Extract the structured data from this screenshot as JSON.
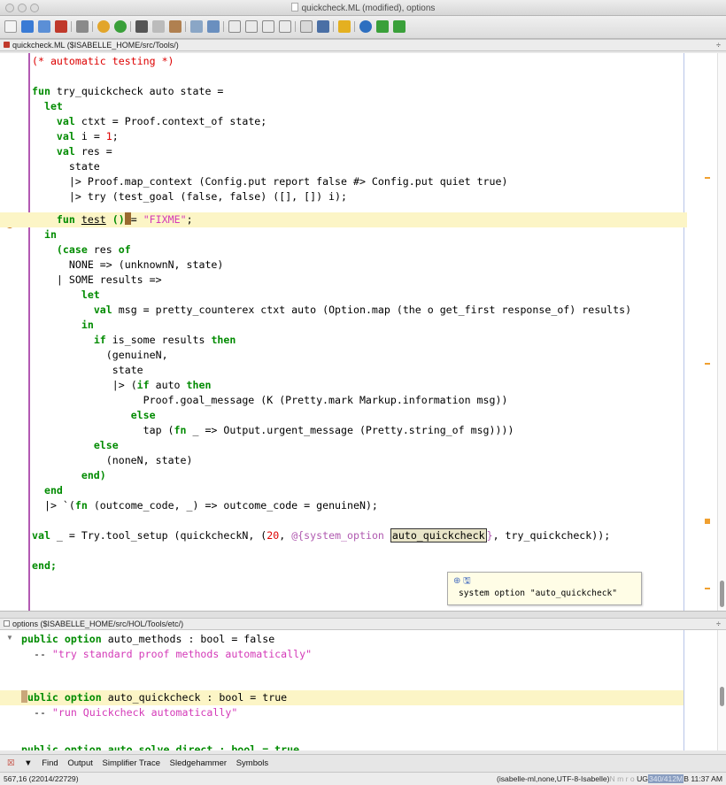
{
  "window": {
    "title": "quickcheck.ML (modified), options"
  },
  "buffer1": {
    "label": "quickcheck.ML ($ISABELLE_HOME/src/Tools/)",
    "dropdown": "÷"
  },
  "buffer2": {
    "label": "options ($ISABELLE_HOME/src/HOL/Tools/etc/)",
    "dropdown": "÷"
  },
  "code": {
    "l01": "(* automatic testing *)",
    "l03a": "fun",
    "l03b": " try_quickcheck auto state =",
    "l04": "let",
    "l05a": "val",
    "l05b": " ctxt = Proof.context_of state;",
    "l06a": "val",
    "l06b": " i = ",
    "l06c": "1",
    "l06d": ";",
    "l07a": "val",
    "l07b": " res =",
    "l08": "state",
    "l09": "|> Proof.map_context (Config.put report false #> Config.put quiet true)",
    "l10": "|> try (test_goal (false, false) ([], []) i);",
    "l11a": "fun",
    "l11b": "test",
    "l11c": " ()",
    "l11d": "= ",
    "l11e": "\"FIXME\"",
    "l11f": ";",
    "l12": "in",
    "l13a": "(",
    "l13b": "case",
    "l13c": " res ",
    "l13d": "of",
    "l14": "NONE => (unknownN, state)",
    "l15": "| SOME results =>",
    "l16": "let",
    "l17a": "val",
    "l17b": " msg = pretty_counterex ctxt auto (Option.map (the o get_first response_of) results)",
    "l18": "in",
    "l19a": "if",
    "l19b": " is_some results ",
    "l19c": "then",
    "l20": "(genuineN,",
    "l21": "state",
    "l22a": "|> (",
    "l22b": "if",
    "l22c": " auto ",
    "l22d": "then",
    "l23": "Proof.goal_message (K (Pretty.mark Markup.information msg))",
    "l24": "else",
    "l25a": "tap (",
    "l25b": "fn",
    "l25c": " _ => Output.urgent_message (Pretty.string_of msg))))",
    "l26": "else",
    "l27": "(noneN, state)",
    "l28": "end)",
    "l29": "end",
    "l30a": "|> `(",
    "l30b": "fn",
    "l30c": " (outcome_code, _) => outcome_code = genuineN);",
    "l32a": "val",
    "l32b": " _ = Try.tool_setup (quickcheckN, (",
    "l32c": "20",
    "l32d": ", ",
    "l32e": "@{system_option ",
    "l32f": "auto_quickcheck",
    "l32g": "}",
    "l32h": ", try_quickcheck));",
    "l34": "end;"
  },
  "tooltip": {
    "icons": "⊕ 🖫",
    "text": "system option \"auto_quickcheck\""
  },
  "options": {
    "o1a": "public option",
    "o1b": " auto_methods : bool = false",
    "o2a": "  -- ",
    "o2b": "\"try standard proof methods automatically\"",
    "o3a": "ublic option",
    "o3b": " auto_quickcheck : bool = true",
    "o4a": "  -- ",
    "o4b": "\"run Quickcheck automatically\"",
    "o5": "public option auto_solve_direct : bool = true"
  },
  "dock": {
    "close": "☒",
    "arrow": "▼",
    "items": [
      "Find",
      "Output",
      "Simplifier Trace",
      "Sledgehammer",
      "Symbols"
    ]
  },
  "status": {
    "position": "567,16 (22014/22729)",
    "mode": "(isabelle-ml,none,UTF-8-Isabelle)",
    "flags": "N m r o",
    "ug": "UG",
    "memory": "340/412M",
    "mem_suffix": "B",
    "time": "11:37 AM"
  },
  "colors": {
    "keyword": "#008b00",
    "string": "#d43ab8",
    "number": "#dd0000",
    "highlight": "#fcf5c6",
    "gutter_border": "#b35ab3"
  }
}
